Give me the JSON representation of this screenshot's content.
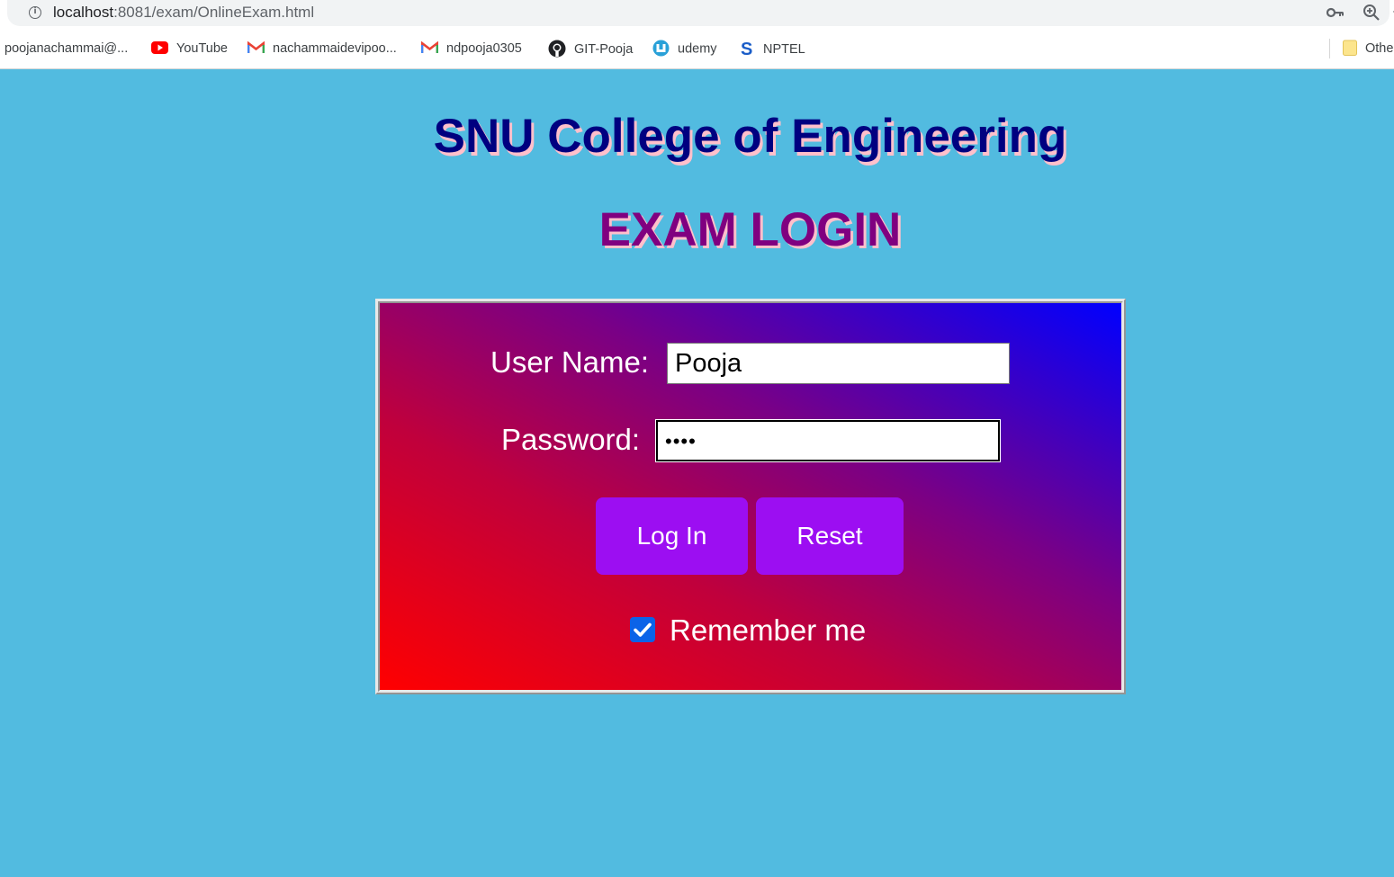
{
  "browser": {
    "url_host": "localhost",
    "url_path": ":8081/exam/OnlineExam.html",
    "bookmarks": [
      {
        "label": "poojanachammai@...",
        "icon": "none"
      },
      {
        "label": "YouTube",
        "icon": "youtube-icon"
      },
      {
        "label": "nachammaidevipoo...",
        "icon": "gmail-icon"
      },
      {
        "label": "ndpooja0305",
        "icon": "gmail-icon"
      },
      {
        "label": "GIT-Pooja",
        "icon": "github-icon"
      },
      {
        "label": "udemy",
        "icon": "udemy-icon"
      },
      {
        "label": "NPTEL",
        "icon": "nptel-icon"
      },
      {
        "label": "Othe",
        "icon": "folder-icon"
      }
    ]
  },
  "page": {
    "title": "SNU College of Engineering",
    "subtitle": "EXAM LOGIN"
  },
  "form": {
    "username_label": "User Name:",
    "username_value": "Pooja",
    "password_label": "Password:",
    "password_display": "••••",
    "login_label": "Log In",
    "reset_label": "Reset",
    "remember_label": "Remember me",
    "remember_checked": true
  },
  "colors": {
    "background": "#52bbe0",
    "title": "#000080",
    "subtitle": "#800080",
    "title_shadow": "#ffc0cb",
    "button": "#9c0ef2",
    "panel_gradient_start": "#ff0000",
    "panel_gradient_end": "#0000ff"
  }
}
